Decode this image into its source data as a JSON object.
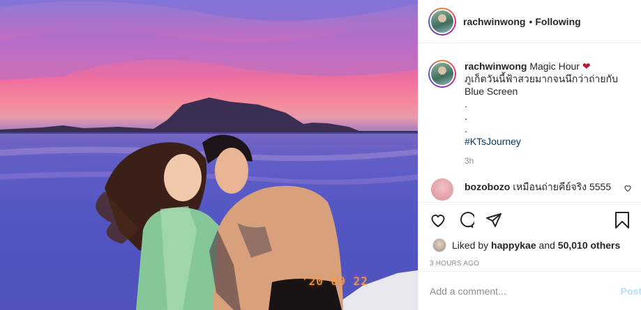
{
  "post": {
    "username": "rachwinwong",
    "dot": "•",
    "follow_status": "Following",
    "caption": {
      "username": "rachwinwong",
      "title": "Magic Hour",
      "emoji": "❤",
      "line2": "ภูเก็ตวันนี้ฟ้าสวยมากจนนึกว่าถ่ายกับ Blue Screen",
      "dots": [
        ".",
        ".",
        "."
      ],
      "hashtag": "#KTsJourney"
    },
    "time_ago": "3h",
    "comment": {
      "username": "bozobozo",
      "text": "เหมือนถ่ายคีย์จริง 5555"
    },
    "likes": {
      "prefix": "Liked by",
      "user": "happykae",
      "and": "and",
      "count": "50,010 others"
    },
    "posted": "3 HOURS AGO",
    "add_comment_placeholder": "Add a comment...",
    "post_button": "Post"
  },
  "photo": {
    "date_stamp": "'20 09 22"
  },
  "icons": {
    "like": "heart-icon",
    "comment": "comment-icon",
    "share": "share-icon",
    "save": "bookmark-icon"
  }
}
